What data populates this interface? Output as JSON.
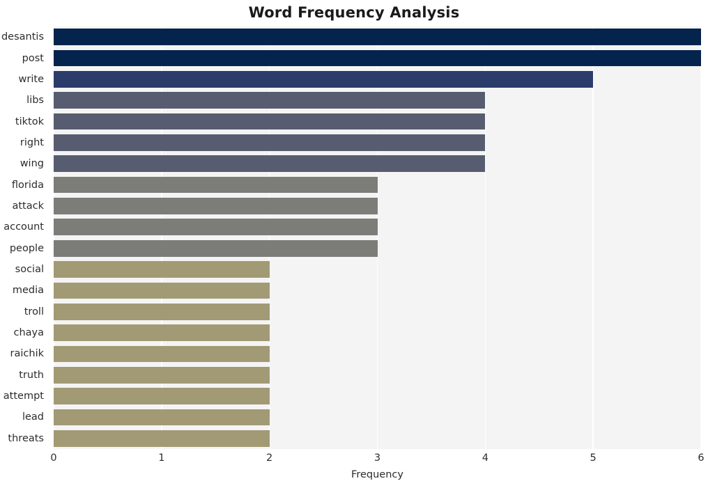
{
  "chart_data": {
    "type": "bar",
    "orientation": "horizontal",
    "title": "Word Frequency Analysis",
    "xlabel": "Frequency",
    "ylabel": "",
    "xlim": [
      0,
      6
    ],
    "xticks": [
      "0",
      "1",
      "2",
      "3",
      "4",
      "5",
      "6"
    ],
    "grid": true,
    "legend": "none",
    "categories": [
      "desantis",
      "post",
      "write",
      "libs",
      "tiktok",
      "right",
      "wing",
      "florida",
      "attack",
      "account",
      "people",
      "social",
      "media",
      "troll",
      "chaya",
      "raichik",
      "truth",
      "attempt",
      "lead",
      "threats"
    ],
    "values": [
      6,
      6,
      5,
      4,
      4,
      4,
      4,
      3,
      3,
      3,
      3,
      2,
      2,
      2,
      2,
      2,
      2,
      2,
      2,
      2
    ],
    "bar_colors": [
      "#04234d",
      "#04234d",
      "#2b3c6b",
      "#575c70",
      "#575c70",
      "#575c70",
      "#575c70",
      "#7c7c79",
      "#7c7c79",
      "#7c7c79",
      "#7c7c79",
      "#a19a74",
      "#a19a74",
      "#a19a74",
      "#a19a74",
      "#a19a74",
      "#a19a74",
      "#a19a74",
      "#a19a74",
      "#a19a74"
    ]
  },
  "style": {
    "plot_background": "#f4f4f4",
    "gridline_color": "#ffffff",
    "figure_background": "#ffffff",
    "text_color": "#2c2c2c"
  }
}
